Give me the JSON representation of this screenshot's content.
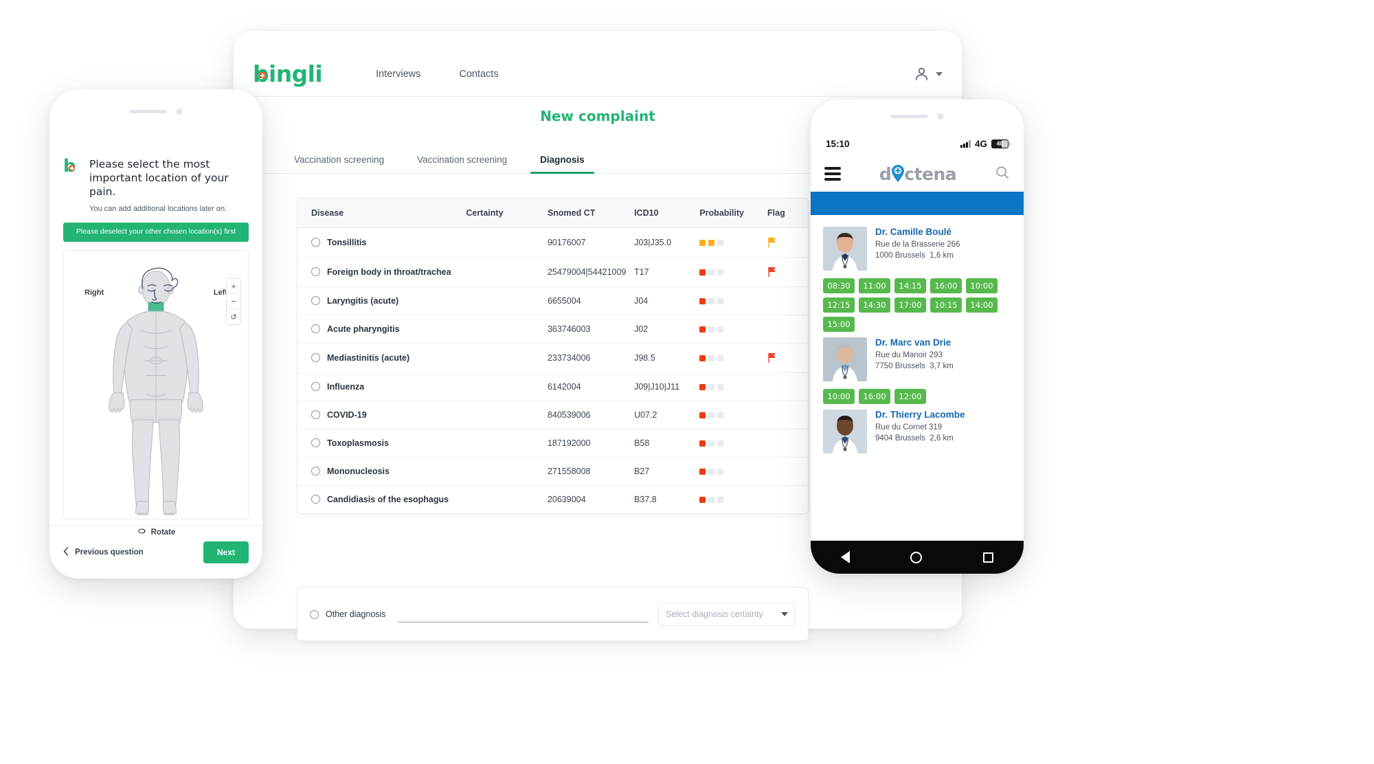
{
  "desktop": {
    "brand": "bingli",
    "nav": [
      {
        "label": "Interviews"
      },
      {
        "label": "Contacts"
      }
    ],
    "page_title": "New complaint",
    "tabs": [
      {
        "label": "Vaccination screening",
        "active": false
      },
      {
        "label": "Vaccination screening",
        "active": false
      },
      {
        "label": "Diagnosis",
        "active": true
      }
    ],
    "tools": [
      "filter-icon",
      "export-table-icon",
      "upload-icon",
      "settings-sliders-icon"
    ],
    "table": {
      "columns": [
        "Disease",
        "Certainty",
        "Snomed CT",
        "ICD10",
        "Probability",
        "Flag"
      ],
      "rows": [
        {
          "disease": "Tonsillitis",
          "certainty": "",
          "snomed": "90176007",
          "icd10": "J03|J35.0",
          "probability": 2,
          "prob_color": "orange",
          "flag": "orange"
        },
        {
          "disease": "Foreign body in throat/trachea",
          "certainty": "",
          "snomed": "25479004|54421009",
          "icd10": "T17",
          "probability": 1,
          "prob_color": "red",
          "flag": "red"
        },
        {
          "disease": "Laryngitis (acute)",
          "certainty": "",
          "snomed": "6655004",
          "icd10": "J04",
          "probability": 1,
          "prob_color": "red",
          "flag": ""
        },
        {
          "disease": "Acute pharyngitis",
          "certainty": "",
          "snomed": "363746003",
          "icd10": "J02",
          "probability": 1,
          "prob_color": "red",
          "flag": ""
        },
        {
          "disease": "Mediastinitis (acute)",
          "certainty": "",
          "snomed": "233734006",
          "icd10": "J98.5",
          "probability": 1,
          "prob_color": "red",
          "flag": "red"
        },
        {
          "disease": "Influenza",
          "certainty": "",
          "snomed": "6142004",
          "icd10": "J09|J10|J11",
          "probability": 1,
          "prob_color": "red",
          "flag": ""
        },
        {
          "disease": "COVID-19",
          "certainty": "",
          "snomed": "840539006",
          "icd10": "U07.2",
          "probability": 1,
          "prob_color": "red",
          "flag": ""
        },
        {
          "disease": "Toxoplasmosis",
          "certainty": "",
          "snomed": "187192000",
          "icd10": "B58",
          "probability": 1,
          "prob_color": "red",
          "flag": ""
        },
        {
          "disease": "Mononucleosis",
          "certainty": "",
          "snomed": "271558008",
          "icd10": "B27",
          "probability": 1,
          "prob_color": "red",
          "flag": ""
        },
        {
          "disease": "Candidiasis of the esophagus",
          "certainty": "",
          "snomed": "20639004",
          "icd10": "B37.8",
          "probability": 1,
          "prob_color": "red",
          "flag": ""
        }
      ]
    },
    "other_diagnosis": {
      "label": "Other diagnosis",
      "input_value": "",
      "select_placeholder": "Select diagnosis certainty"
    },
    "accent_color": "#23b474"
  },
  "phone_left": {
    "question_title": "Please select the most important location of your pain.",
    "question_sub": "You can add additional locations later on.",
    "warning": "Please deselect your other chosen location(s) first",
    "label_right": "Right",
    "label_left": "Left",
    "zoom_in": "+",
    "zoom_out": "−",
    "reset": "↺",
    "rotate": "Rotate",
    "previous": "Previous question",
    "next": "Next",
    "highlight_color": "#4cbb8e"
  },
  "phone_right": {
    "status": {
      "time": "15:10",
      "network": "4G",
      "battery": "40"
    },
    "app_name": "doctena",
    "doctors": [
      {
        "name": "Dr. Camille Boulé",
        "street": "Rue de la Brasserie 266",
        "city": "1000 Brussels",
        "distance": "1,6 km",
        "slots": [
          "08:30",
          "11:00",
          "14:15",
          "16:00",
          "10:00",
          "12:15",
          "14:30",
          "17:00",
          "10:15",
          "14:00",
          "15:00"
        ]
      },
      {
        "name": "Dr. Marc van Drie",
        "street": "Rue du Manoir 293",
        "city": "7750 Brussels",
        "distance": "3,7 km",
        "slots": [
          "10:00",
          "16:00",
          "12:00"
        ]
      },
      {
        "name": "Dr. Thierry Lacombe",
        "street": "Rue du Cornet 319",
        "city": "9404 Brussels",
        "distance": "2,6 km",
        "slots": []
      }
    ],
    "slot_color": "#56b94c",
    "band_color": "#0b74c4"
  }
}
